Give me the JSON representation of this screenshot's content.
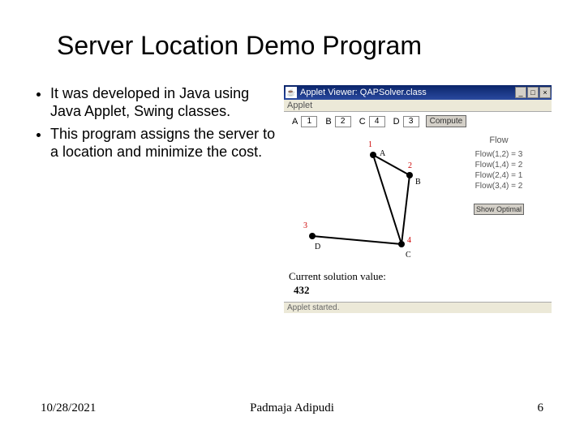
{
  "title": "Server Location Demo Program",
  "bullets": [
    "It was developed in Java using Java Applet, Swing classes.",
    "This program assigns the server to a location and minimize the cost."
  ],
  "applet": {
    "window_title": "Applet Viewer: QAPSolver.class",
    "menu_item": "Applet",
    "inputs": {
      "A": "1",
      "B": "2",
      "C": "4",
      "D": "3"
    },
    "compute_label": "Compute",
    "side_header": "Flow",
    "flows": [
      "Flow(1,2) = 3",
      "Flow(1,4) = 2",
      "Flow(2,4) = 1",
      "Flow(3,4) = 2"
    ],
    "show_optimal_label": "Show Optimal",
    "solution_label": "Current solution value:",
    "solution_value": "432",
    "status": "Applet started.",
    "nodes": {
      "n1": {
        "num": "1",
        "letter": "A"
      },
      "n2": {
        "num": "2",
        "letter": "B"
      },
      "n3": {
        "num": "3",
        "letter": "D"
      },
      "n4": {
        "num": "4",
        "letter": "C"
      }
    }
  },
  "footer": {
    "date": "10/28/2021",
    "author": "Padmaja Adipudi",
    "page": "6"
  }
}
